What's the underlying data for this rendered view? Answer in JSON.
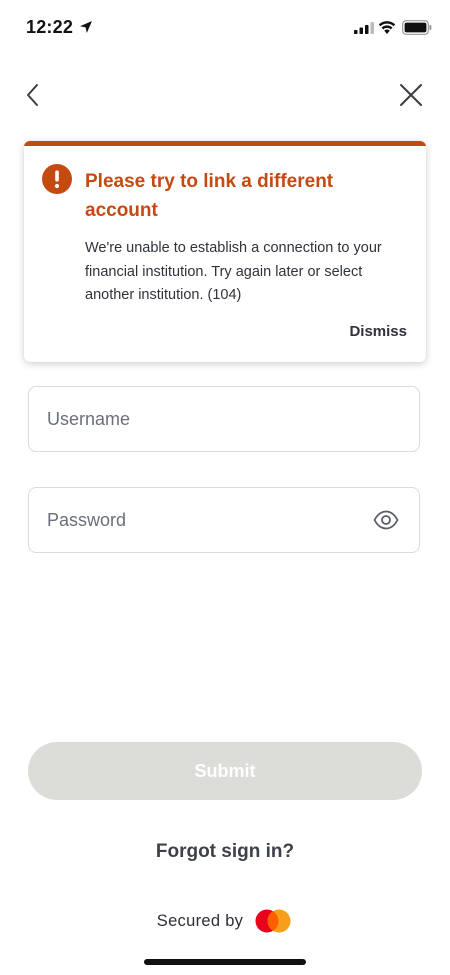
{
  "status_bar": {
    "time": "12:22",
    "icons": [
      "location-arrow-icon",
      "signal-icon",
      "wifi-icon",
      "battery-icon"
    ]
  },
  "nav": {
    "back_icon": "chevron-left-icon",
    "close_icon": "close-icon"
  },
  "error": {
    "icon": "alert-circle-icon",
    "title": "Please try to link a different account",
    "message": "We're unable to establish a connection to your financial institution. Try again later or select another institution. (104)",
    "dismiss_label": "Dismiss",
    "accent_color": "#c54a12"
  },
  "form": {
    "username_placeholder": "Username",
    "username_value": "",
    "password_placeholder": "Password",
    "password_value": "",
    "password_toggle_icon": "eye-icon",
    "submit_label": "Submit",
    "submit_disabled": true
  },
  "forgot_label": "Forgot sign in?",
  "footer": {
    "secured_label": "Secured by",
    "logo": "mastercard-logo"
  }
}
